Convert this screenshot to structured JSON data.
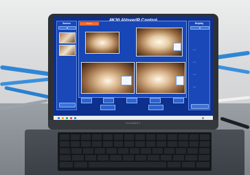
{
  "app": {
    "title": "4K30 AVoverIP Control",
    "panel_left_title": "Source",
    "panel_right_title": "Display",
    "laptop_brand": "HUAWEI"
  },
  "bottom_buttons": [
    "Apply",
    "Save",
    "Scene",
    "Reboot",
    "Cascade"
  ],
  "status_tabs": [
    "Preset",
    "Default"
  ],
  "colors": {
    "app_background": "#0d2f8e",
    "panel": "#1a48b8",
    "accent_tab": "#ff6a2c"
  }
}
